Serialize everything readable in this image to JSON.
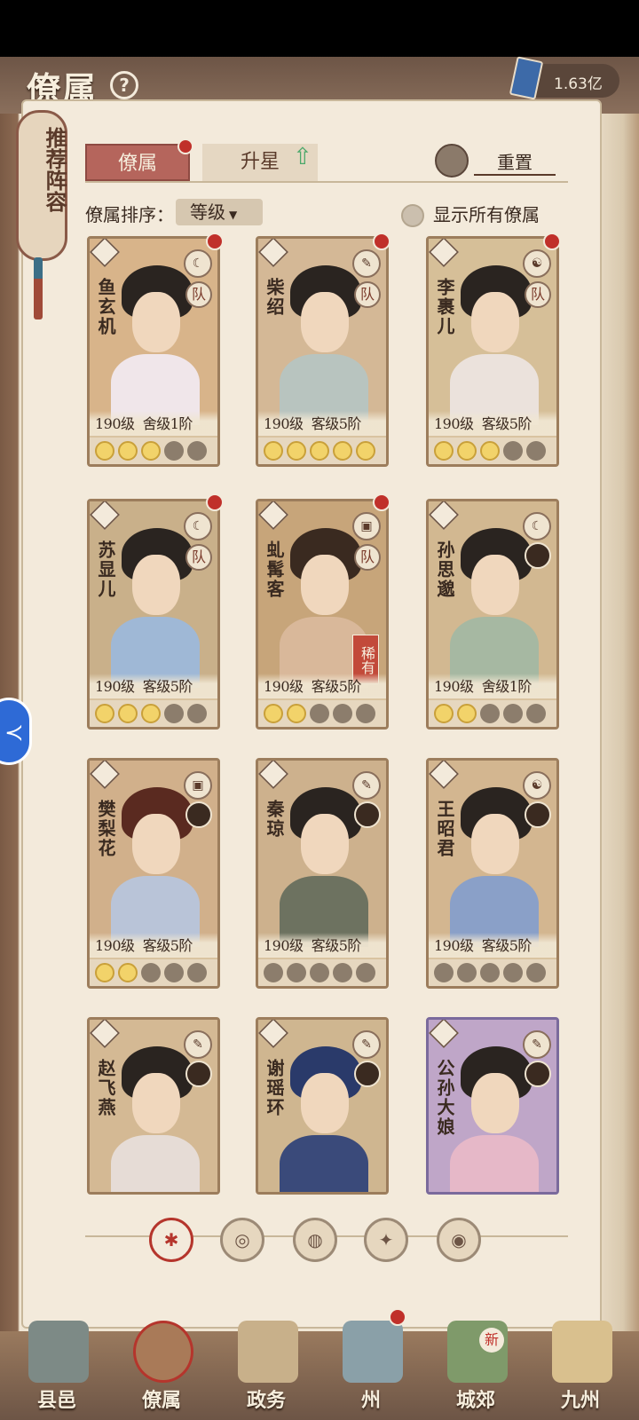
{
  "header": {
    "title": "僚属",
    "help": "?",
    "currency": "1.63亿"
  },
  "recommend": {
    "label": "推荐阵容"
  },
  "tabs": [
    {
      "label": "僚属",
      "active": true
    },
    {
      "label": "升星",
      "active": false
    }
  ],
  "reset_label": "重置",
  "sort": {
    "label": "僚属排序：",
    "value": "等级"
  },
  "show_all_label": "显示所有僚属",
  "cards": [
    {
      "name": "鱼玄机",
      "level": "190级",
      "rank": "舍级1阶",
      "stars": 3,
      "skill": "☾",
      "team": "队"
    },
    {
      "name": "柴绍",
      "level": "190级",
      "rank": "客级5阶",
      "stars": 5,
      "skill": "✎",
      "team": "队"
    },
    {
      "name": "李裹儿",
      "level": "190级",
      "rank": "客级5阶",
      "stars": 3,
      "skill": "☯",
      "team": "队"
    },
    {
      "name": "苏显儿",
      "level": "190级",
      "rank": "客级5阶",
      "stars": 3,
      "skill": "☾",
      "team": "队"
    },
    {
      "name": "虬髯客",
      "level": "190级",
      "rank": "客级5阶",
      "stars": 2,
      "skill": "▣",
      "team": "队",
      "tag": "稀有"
    },
    {
      "name": "孙思邈",
      "level": "190级",
      "rank": "舍级1阶",
      "stars": 2,
      "skill": "☾",
      "team": ""
    },
    {
      "name": "樊梨花",
      "level": "190级",
      "rank": "客级5阶",
      "stars": 2,
      "skill": "▣",
      "team": ""
    },
    {
      "name": "秦琼",
      "level": "190级",
      "rank": "客级5阶",
      "stars": 0,
      "skill": "✎",
      "team": ""
    },
    {
      "name": "王昭君",
      "level": "190级",
      "rank": "客级5阶",
      "stars": 0,
      "skill": "☯",
      "team": ""
    },
    {
      "name": "赵飞燕",
      "level": "",
      "rank": "",
      "stars": 0,
      "skill": "✎",
      "team": ""
    },
    {
      "name": "谢瑶环",
      "level": "",
      "rank": "",
      "stars": 0,
      "skill": "✎",
      "team": ""
    },
    {
      "name": "公孙大娘",
      "level": "",
      "rank": "",
      "stars": 0,
      "skill": "✎",
      "team": ""
    }
  ],
  "filters": [
    "✱",
    "◎",
    "◍",
    "✦",
    "◉"
  ],
  "nav": [
    {
      "label": "县邑"
    },
    {
      "label": "僚属"
    },
    {
      "label": "政务"
    },
    {
      "label": "州"
    },
    {
      "label": "城郊"
    },
    {
      "label": "九州"
    }
  ],
  "nav_new": "新",
  "colors": {
    "accent": "#b5655c",
    "paper": "#f3eadb",
    "wood": "#6d5546",
    "alert": "#c0302a"
  }
}
